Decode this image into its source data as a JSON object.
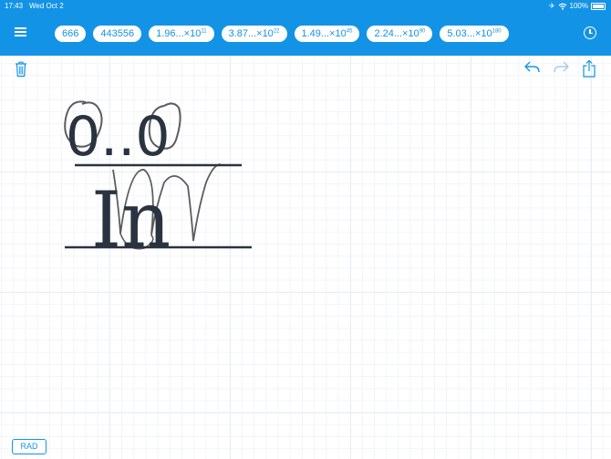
{
  "status_bar": {
    "time": "17:43",
    "date": "Wed Oct 2",
    "battery": "100%"
  },
  "history": [
    {
      "base": "666",
      "exp": ""
    },
    {
      "base": "443556",
      "exp": ""
    },
    {
      "base": "1.96...×10",
      "exp": "11"
    },
    {
      "base": "3.87...×10",
      "exp": "22"
    },
    {
      "base": "1.49...×10",
      "exp": "45"
    },
    {
      "base": "2.24...×10",
      "exp": "90"
    },
    {
      "base": "5.03...×10",
      "exp": "180"
    }
  ],
  "expression": {
    "numerator": "0..0",
    "denominator": "In"
  },
  "angle_mode": "RAD",
  "icons": {
    "menu": "menu-icon",
    "clock": "clock-icon",
    "trash": "trash-icon",
    "undo": "undo-icon",
    "redo": "redo-icon",
    "share": "share-icon"
  },
  "colors": {
    "brand": "#1393e6",
    "ink": "#2a3340",
    "stroke": "#5c5c5c",
    "disabled": "#a9c9ea"
  }
}
